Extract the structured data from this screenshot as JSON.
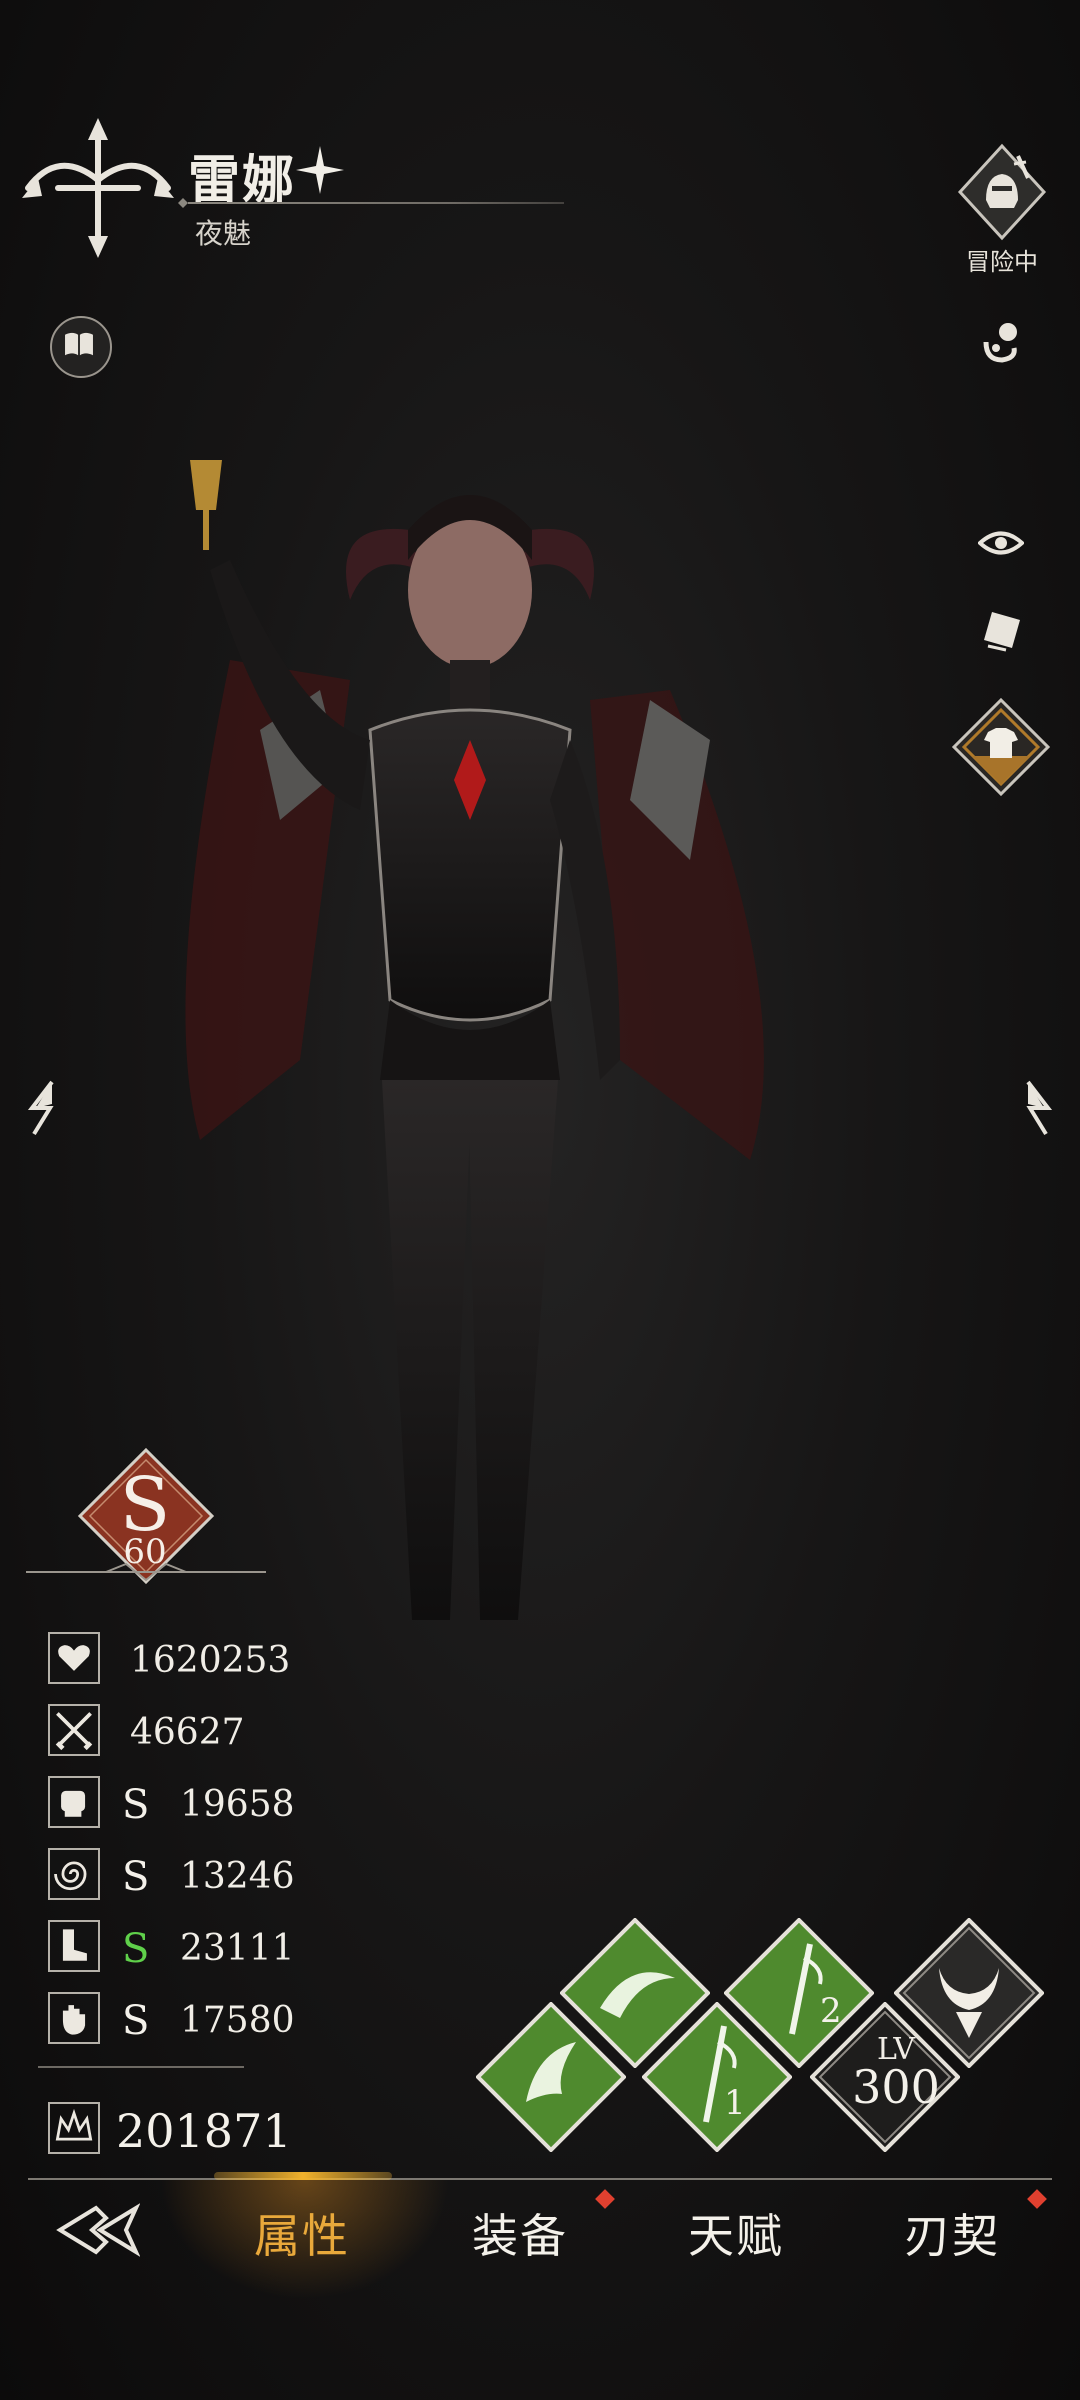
{
  "header": {
    "character_name": "雷娜",
    "character_title": "夜魅",
    "status_label": "冒险中"
  },
  "rank": {
    "letter": "S",
    "level": "60"
  },
  "stats": [
    {
      "icon": "heart-icon",
      "grade": "",
      "value": "1620253"
    },
    {
      "icon": "crossed-swords-icon",
      "grade": "",
      "value": "46627"
    },
    {
      "icon": "fist-icon",
      "grade": "S",
      "value": "19658"
    },
    {
      "icon": "swirl-icon",
      "grade": "S",
      "value": "13246"
    },
    {
      "icon": "boot-icon",
      "grade": "S",
      "value": "23111"
    },
    {
      "icon": "hand-icon",
      "grade": "S",
      "value": "17580"
    }
  ],
  "power": {
    "icon": "crown-icon",
    "value": "201871"
  },
  "level": {
    "label": "LV",
    "value": "300"
  },
  "skills": {
    "skill_2_label": "2",
    "skill_1_label": "1"
  },
  "nav": {
    "tabs": [
      "属性",
      "装备",
      "天赋",
      "刃契"
    ],
    "active_index": 0
  },
  "colors": {
    "accent_gold": "#e9a93b",
    "grade_green": "#5fd04a",
    "skill_green": "#4f8a2e",
    "rank_red": "#8a3321",
    "notification_red": "#e0402f"
  }
}
